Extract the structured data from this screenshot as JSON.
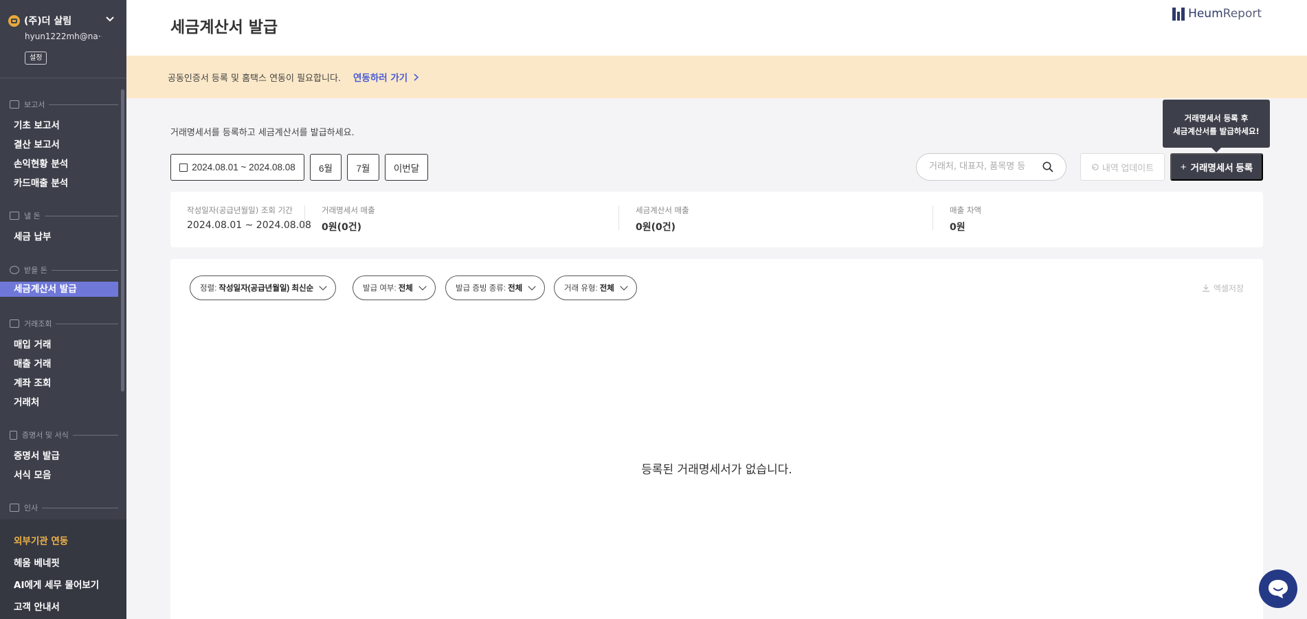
{
  "sidebar": {
    "company_name": "(주)더 살림",
    "user_email": "hyun1222mh@na···",
    "settings_label": "설정",
    "sections": {
      "reports": {
        "title": "보고서",
        "items": [
          "기초 보고서",
          "결산 보고서",
          "손익현황 분석",
          "카드매출 분석"
        ]
      },
      "pay": {
        "title": "낼 돈",
        "items": [
          "세금 납부"
        ]
      },
      "receive": {
        "title": "받을 돈",
        "items": [
          "세금계산서 발급"
        ]
      },
      "transactions": {
        "title": "거래조회",
        "items": [
          "매입 거래",
          "매출 거래",
          "계좌 조회",
          "거래처"
        ]
      },
      "certs": {
        "title": "증명서 및 서식",
        "items": [
          "증명서 발급",
          "서식 모음"
        ]
      },
      "hr": {
        "title": "인사"
      }
    },
    "bottom_items": [
      "외부기관 연동",
      "헤움 베네핏",
      "AI에게 세무 물어보기",
      "고객 안내서"
    ]
  },
  "header": {
    "title": "세금계산서 발급",
    "brand_heum": "Heum",
    "brand_report": "Report"
  },
  "banner": {
    "text": "공동인증서 등록 및 홈택스 연동이 필요합니다.",
    "link": "연동하러 가기"
  },
  "main": {
    "intro": "거래명세서를 등록하고 세금계산서를 발급하세요.",
    "date_range": "2024.08.01 ~ 2024.08.08",
    "month_june": "6월",
    "month_july": "7월",
    "month_this": "이번달",
    "search_placeholder": "거래처, 대표자, 품목명 등",
    "update_label": "내역 업데이트",
    "register_label": "거래명세서 등록",
    "tooltip_line1": "거래명세서 등록 후",
    "tooltip_line2": "세금계산서를 발급하세요!"
  },
  "summary": {
    "period_label": "작성일자(공급년월일) 조회 기간",
    "period_value": "2024.08.01 ~ 2024.08.08",
    "statement_label": "거래명세서 매출",
    "statement_value": "0원(0건)",
    "invoice_label": "세금계산서 매출",
    "invoice_value": "0원(0건)",
    "diff_label": "매출 차액",
    "diff_value": "0원"
  },
  "filters": [
    {
      "label": "정렬:",
      "value": "작성일자(공급년월일) 최신순"
    },
    {
      "label": "발급 여부:",
      "value": "전체"
    },
    {
      "label": "발급 증빙 종류:",
      "value": "전체"
    },
    {
      "label": "거래 유형:",
      "value": "전체"
    }
  ],
  "excel_label": "엑셀저장",
  "empty_message": "등록된 거래명세서가 없습니다.",
  "colors": {
    "sidebar_bg": "#3d3f4a",
    "active_item": "#6f78d9",
    "banner_bg": "#fbe8c8",
    "link": "#4a5bd6",
    "highlight": "#f0b34a",
    "chat_button": "#253a86"
  }
}
